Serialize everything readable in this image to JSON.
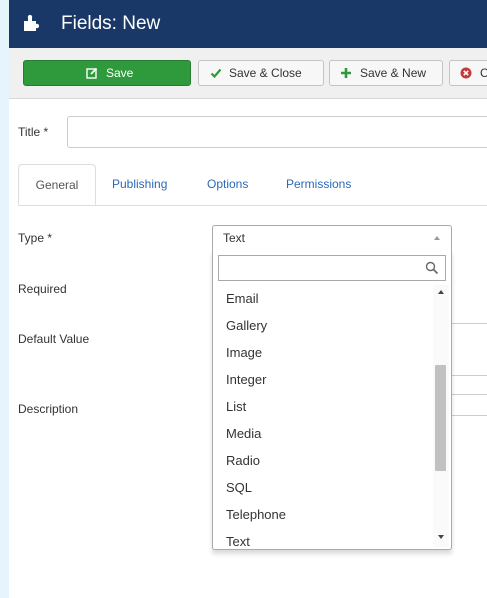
{
  "header": {
    "title": "Fields: New",
    "icon": "puzzle-icon"
  },
  "toolbar": {
    "save_label": "Save",
    "save_close_label": "Save & Close",
    "save_new_label": "Save & New",
    "cancel_label": "Ca"
  },
  "form": {
    "title_label": "Title *",
    "title_value": "",
    "type_label": "Type *",
    "required_label": "Required",
    "default_value_label": "Default Value",
    "description_label": "Description"
  },
  "tabs": [
    "General",
    "Publishing",
    "Options",
    "Permissions"
  ],
  "type_select": {
    "selected": "Text",
    "search_value": "",
    "options": [
      "Email",
      "Gallery",
      "Image",
      "Integer",
      "List",
      "Media",
      "Radio",
      "SQL",
      "Telephone",
      "Text"
    ]
  },
  "colors": {
    "header_bg": "#1a3867",
    "save_green": "#2f9a3c",
    "link_blue": "#2a69b8",
    "cancel_red": "#c33a3a"
  }
}
